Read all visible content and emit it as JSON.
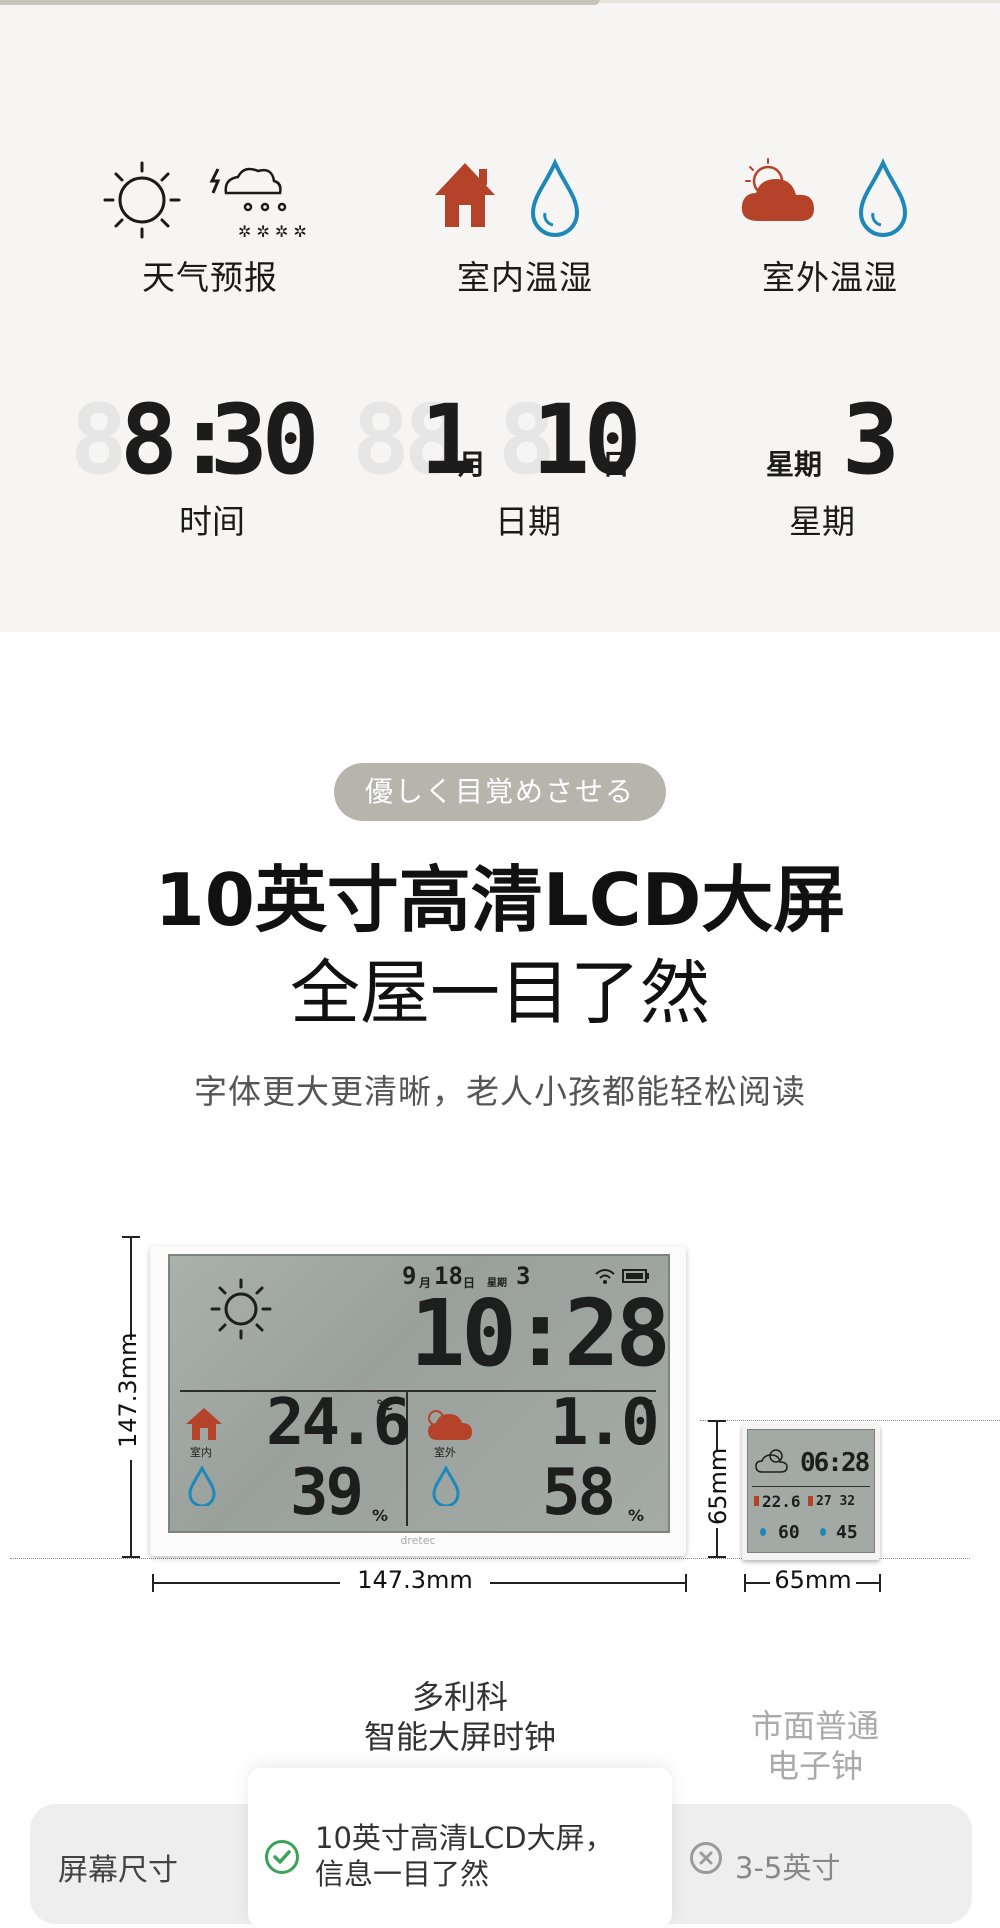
{
  "features": [
    {
      "label": "天气预报"
    },
    {
      "label": "室内温湿"
    },
    {
      "label": "室外温湿"
    }
  ],
  "lcd_demo": {
    "time": {
      "ghost": "8",
      "hour": "8",
      "colon": ":",
      "minute": "30",
      "label": "时间"
    },
    "date": {
      "ghost": "88",
      "month": "1",
      "month_unit": "月",
      "day_ghost": "8",
      "day": "10",
      "day_unit": "日",
      "label": "日期"
    },
    "week": {
      "prefix": "星期",
      "value": "3",
      "label": "星期"
    }
  },
  "section": {
    "tag": "優しく目覚めさせる",
    "headline": "10英寸高清LCD大屏",
    "headline2": "全屋一目了然",
    "subtitle": "字体更大更清晰，老人小孩都能轻松阅读"
  },
  "big_device": {
    "height_label": "147.3mm",
    "width_label": "147.3mm",
    "month": "9",
    "month_unit": "月",
    "day": "18",
    "day_unit": "日",
    "week_prefix": "星期",
    "week": "3",
    "time": "10:28",
    "indoor_label": "室内",
    "outdoor_label": "室外",
    "indoor_temp": "24.6",
    "indoor_hum": "39",
    "outdoor_temp": "1.0",
    "outdoor_hum": "58",
    "temp_unit": "℃",
    "hum_unit": "%",
    "logo": "dretec"
  },
  "small_device": {
    "height_label": "65mm",
    "width_label": "65mm",
    "time": "06:28",
    "temp_in": "22.6",
    "temp_out": "27 32",
    "hum_in": "60",
    "hum_out": "45"
  },
  "comparison": {
    "brand_title": "多利科\n智能大屏时钟",
    "brand_line1": "多利科",
    "brand_line2": "智能大屏时钟",
    "other_line1": "市面普通",
    "other_line2": "电子钟",
    "row_label": "屏幕尺寸",
    "brand_value_1": "10英寸高清LCD大屏，",
    "brand_value_2": "信息一目了然",
    "other_value": "3-5英寸"
  },
  "colors": {
    "accent_red": "#b5432a",
    "water_blue": "#1e88b8",
    "pill_bg": "#b7b5ab",
    "check_green": "#3aa35a"
  }
}
